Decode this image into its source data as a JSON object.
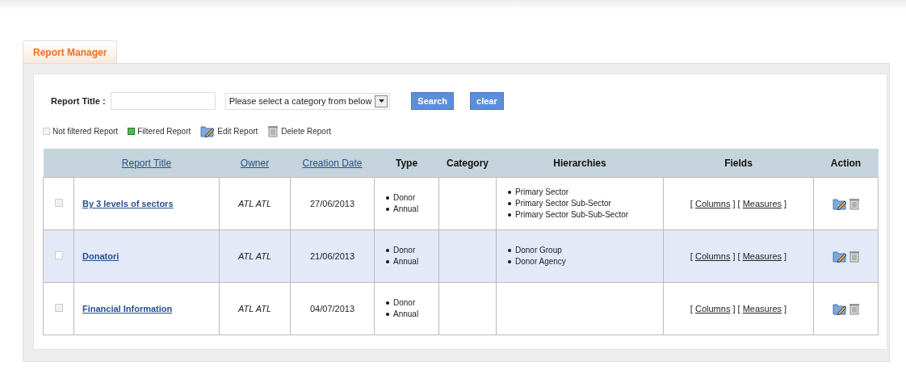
{
  "tabs": [
    {
      "label": "Report Manager",
      "selected": true
    }
  ],
  "filter": {
    "label": "Report Title :",
    "category": "Please select a category from below",
    "buttons": [
      "Search",
      "clear"
    ]
  },
  "legend": [
    {
      "kind": "empty-box",
      "label": "Not filtered Report"
    },
    {
      "kind": "green-box",
      "label": "Filtered Report"
    },
    {
      "kind": "edit",
      "label": "Edit Report"
    },
    {
      "kind": "delete",
      "label": "Delete Report"
    }
  ],
  "table": {
    "columns": [
      {
        "kind": "blank"
      },
      {
        "kind": "link",
        "label": "Report Title"
      },
      {
        "kind": "link",
        "label": "Owner"
      },
      {
        "kind": "link",
        "label": "Creation Date"
      },
      {
        "kind": "text",
        "label": "Type"
      },
      {
        "kind": "text",
        "label": "Category"
      },
      {
        "kind": "text",
        "label": "Hierarchies"
      },
      {
        "kind": "text",
        "label": "Fields"
      },
      {
        "kind": "text",
        "label": "Action"
      }
    ],
    "rows": [
      {
        "selected": false,
        "title": "By 3 levels of sectors",
        "owner": "ATL ATL",
        "date": "27/06/2013",
        "type": [
          "Donor",
          "Annual"
        ],
        "hierarchies": [
          "Primary Sector",
          "Primary Sector Sub-Sector",
          "Primary Sector Sub-Sub-Sector"
        ],
        "fields": [
          {
            "open": "[",
            "link": "Columns",
            "close": "]"
          },
          {
            "open": "[",
            "link": "Measures",
            "close": "]"
          }
        ]
      },
      {
        "selected": true,
        "title": "Donatori",
        "owner": "ATL ATL",
        "date": "21/06/2013",
        "type": [
          "Donor",
          "Annual"
        ],
        "hierarchies": [
          "Donor Group",
          "Donor Agency"
        ],
        "fields": [
          {
            "open": "[",
            "link": "Columns",
            "close": "]"
          },
          {
            "open": "[",
            "link": "Measures",
            "close": "]"
          }
        ]
      },
      {
        "selected": false,
        "title": "Financial Information",
        "owner": "ATL ATL",
        "date": "04/07/2013",
        "type": [
          "Donor",
          "Annual"
        ],
        "hierarchies": [],
        "fields": [
          {
            "open": "[",
            "link": "Columns",
            "close": "]"
          },
          {
            "open": "[",
            "link": "Measures",
            "close": "]"
          }
        ]
      }
    ]
  }
}
